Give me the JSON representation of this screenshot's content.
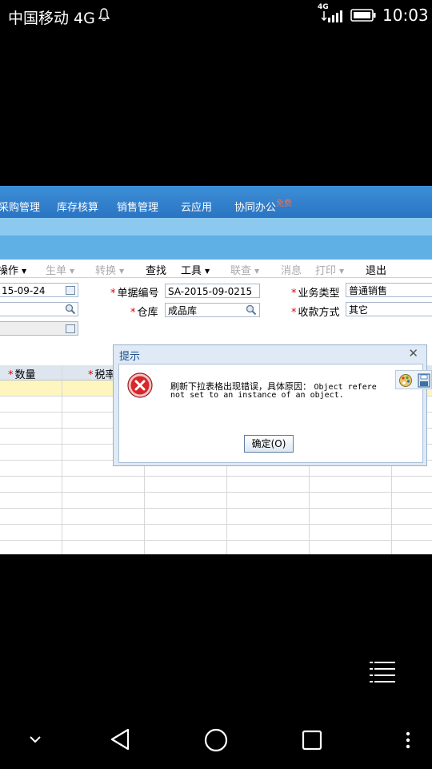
{
  "status_bar": {
    "carrier": "中国移动 4G",
    "network": "4G",
    "time": "10:03"
  },
  "app": {
    "nav_items": [
      "采购管理",
      "库存核算",
      "销售管理",
      "云应用",
      "协同办公"
    ],
    "nav_badge": "免费",
    "toolbar": [
      {
        "label": "操作",
        "arrow": true,
        "enabled": true
      },
      {
        "label": "生单",
        "arrow": true,
        "enabled": false
      },
      {
        "label": "转换",
        "arrow": true,
        "enabled": false
      },
      {
        "label": "查找",
        "arrow": false,
        "enabled": true
      },
      {
        "label": "工具",
        "arrow": true,
        "enabled": true
      },
      {
        "label": "联查",
        "arrow": true,
        "enabled": false
      },
      {
        "label": "消息",
        "arrow": false,
        "enabled": false
      },
      {
        "label": "打印",
        "arrow": true,
        "enabled": false
      },
      {
        "label": "退出",
        "arrow": false,
        "enabled": true
      }
    ],
    "form": {
      "date_value": "15-09-24",
      "doc_no_label": "单据编号",
      "doc_no_value": "SA-2015-09-0215",
      "warehouse_label": "仓库",
      "warehouse_value": "成品库",
      "business_type_label": "业务类型",
      "business_type_value": "普通销售",
      "payment_label": "收款方式",
      "payment_value": "其它"
    },
    "grid_headers": [
      "数量",
      "税率"
    ]
  },
  "dialog": {
    "title": "提示",
    "message_zh": "刷新下拉表格出现错误，具体原因：",
    "message_en_1": "Object refere",
    "message_en_2": "not set to an instance of an object.",
    "ok_label": "确定(O)"
  },
  "colors": {
    "nav_blue": "#2a74c2",
    "required_red": "#dd0000",
    "selected_row": "#fff5bf",
    "error_red": "#d8262b"
  }
}
